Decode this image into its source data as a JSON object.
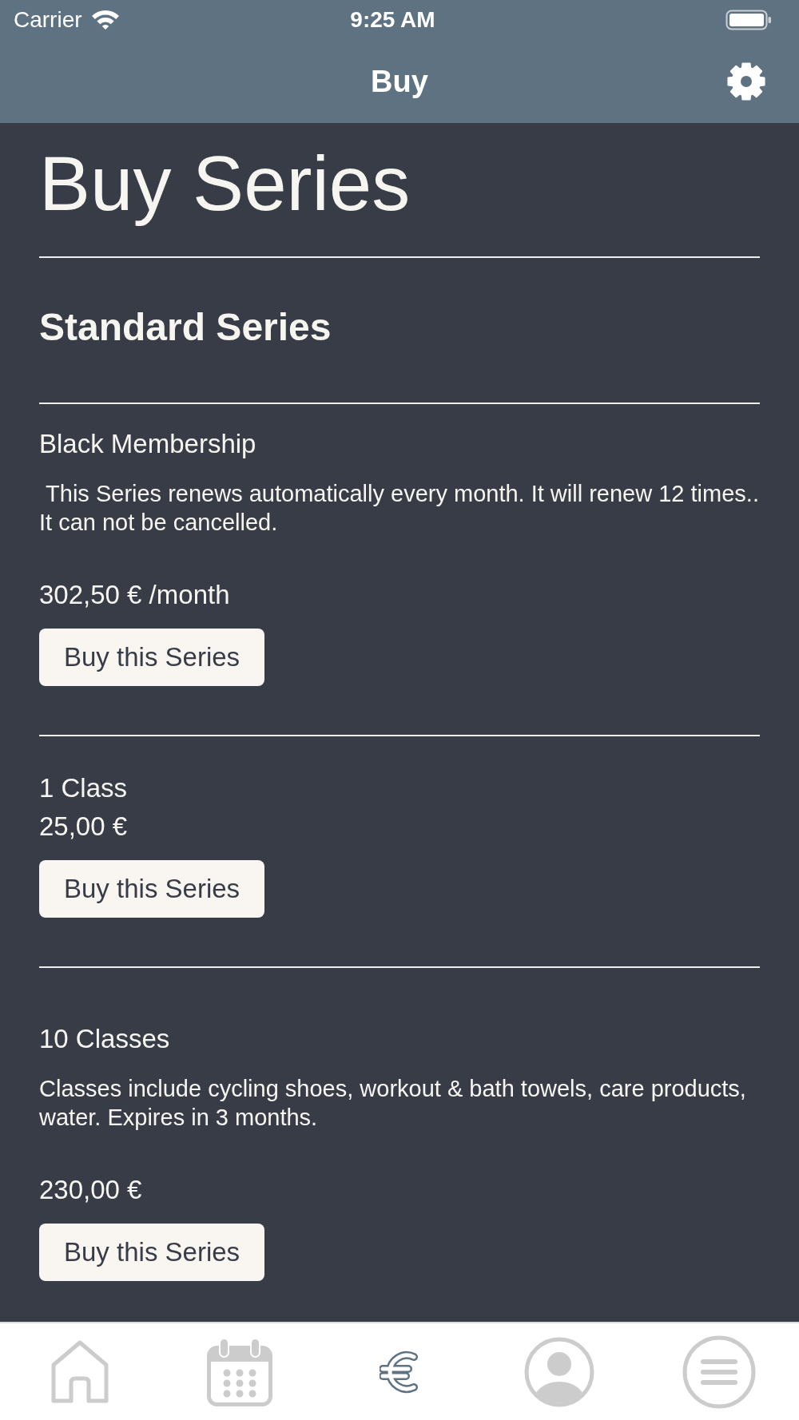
{
  "status_bar": {
    "carrier": "Carrier",
    "time": "9:25 AM"
  },
  "nav_bar": {
    "title": "Buy"
  },
  "page": {
    "title": "Buy Series",
    "section_title": "Standard Series"
  },
  "series": [
    {
      "name": "Black Membership",
      "description": " This Series renews automatically every month. It will renew 12 times.. It can not be cancelled.",
      "price": "302,50 € /month",
      "button": "Buy this Series"
    },
    {
      "name": "1 Class",
      "price": "25,00 €",
      "button": "Buy this Series"
    },
    {
      "name": "10 Classes",
      "description": "Classes include cycling shoes, workout & bath towels, care products, water. Expires in 3 months.",
      "price": "230,00 €",
      "button": "Buy this Series"
    }
  ],
  "tab_bar": {
    "tabs": [
      {
        "kind": "home",
        "selected": false
      },
      {
        "kind": "calendar",
        "selected": false
      },
      {
        "kind": "euro",
        "selected": true
      },
      {
        "kind": "profile",
        "selected": false
      },
      {
        "kind": "menu",
        "selected": false
      }
    ]
  }
}
